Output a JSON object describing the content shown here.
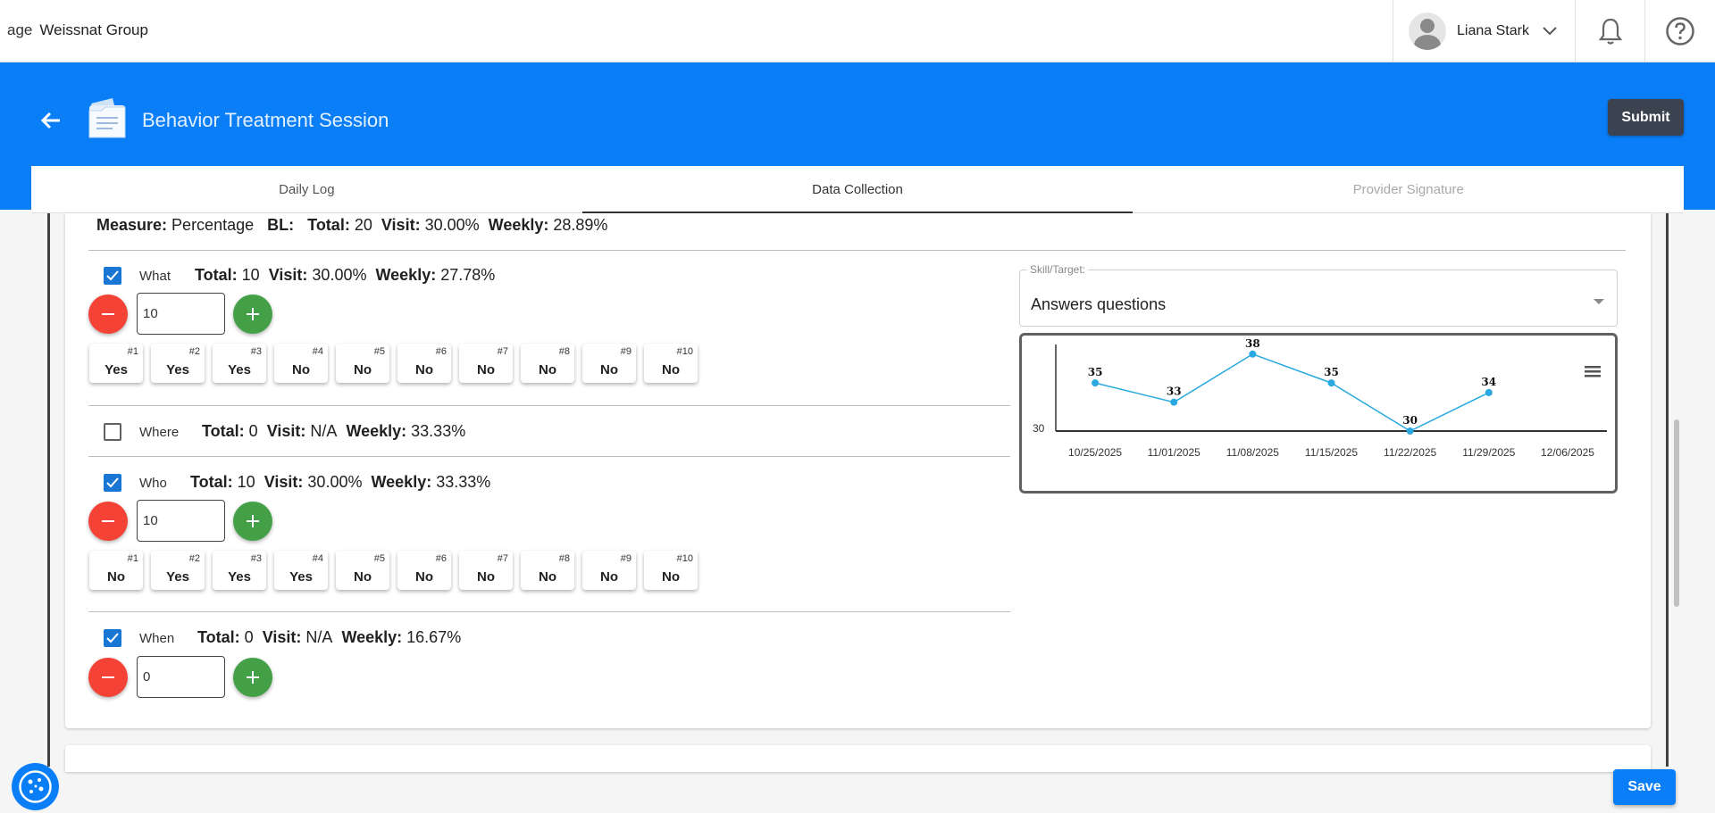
{
  "header": {
    "logo_alt": "age",
    "org_name": "Weissnat Group",
    "user_name": "Liana Stark"
  },
  "page": {
    "title": "Behavior Treatment Session",
    "submit_label": "Submit",
    "save_label": "Save"
  },
  "tabs": [
    {
      "label": "Daily Log",
      "state": "normal"
    },
    {
      "label": "Data Collection",
      "state": "active"
    },
    {
      "label": "Provider Signature",
      "state": "disabled"
    }
  ],
  "measure": {
    "measure_label": "Measure:",
    "measure_value": "Percentage",
    "bl_label": "BL:",
    "total_label": "Total:",
    "total_value": "20",
    "visit_label": "Visit:",
    "visit_value": "30.00%",
    "weekly_label": "Weekly:",
    "weekly_value": "28.89%"
  },
  "questions": [
    {
      "label": "What",
      "checked": true,
      "total": "10",
      "visit": "30.00%",
      "weekly": "27.78%",
      "count": "10",
      "trials": [
        {
          "n": "#1",
          "v": "Yes"
        },
        {
          "n": "#2",
          "v": "Yes"
        },
        {
          "n": "#3",
          "v": "Yes"
        },
        {
          "n": "#4",
          "v": "No"
        },
        {
          "n": "#5",
          "v": "No"
        },
        {
          "n": "#6",
          "v": "No"
        },
        {
          "n": "#7",
          "v": "No"
        },
        {
          "n": "#8",
          "v": "No"
        },
        {
          "n": "#9",
          "v": "No"
        },
        {
          "n": "#10",
          "v": "No"
        }
      ]
    },
    {
      "label": "Where",
      "checked": false,
      "total": "0",
      "visit": "N/A",
      "weekly": "33.33%"
    },
    {
      "label": "Who",
      "checked": true,
      "total": "10",
      "visit": "30.00%",
      "weekly": "33.33%",
      "count": "10",
      "trials": [
        {
          "n": "#1",
          "v": "No"
        },
        {
          "n": "#2",
          "v": "Yes"
        },
        {
          "n": "#3",
          "v": "Yes"
        },
        {
          "n": "#4",
          "v": "Yes"
        },
        {
          "n": "#5",
          "v": "No"
        },
        {
          "n": "#6",
          "v": "No"
        },
        {
          "n": "#7",
          "v": "No"
        },
        {
          "n": "#8",
          "v": "No"
        },
        {
          "n": "#9",
          "v": "No"
        },
        {
          "n": "#10",
          "v": "No"
        }
      ]
    },
    {
      "label": "When",
      "checked": true,
      "total": "0",
      "visit": "N/A",
      "weekly": "16.67%",
      "count": "0"
    }
  ],
  "stat_labels": {
    "total": "Total:",
    "visit": "Visit:",
    "weekly": "Weekly:"
  },
  "skill": {
    "label": "Skill/Target:",
    "value": "Answers questions"
  },
  "chart_data": {
    "type": "line",
    "x": [
      "10/25/2025",
      "11/01/2025",
      "11/08/2025",
      "11/15/2025",
      "11/22/2025",
      "11/29/2025",
      "12/06/2025"
    ],
    "series": [
      {
        "values": [
          35,
          33,
          38,
          35,
          30,
          34,
          null
        ]
      }
    ],
    "y_tick_labels": [
      "30"
    ],
    "ylim": [
      30,
      39
    ],
    "grid": false,
    "line_color": "#29a9e0"
  },
  "icons": {
    "back": "arrow-left-icon",
    "document": "document-icon",
    "bell": "bell-icon",
    "help": "help-icon",
    "menu": "hamburger-menu-icon",
    "cookie": "cookie-icon"
  },
  "colors": {
    "brand_blue": "#0a7ef7",
    "minus_red": "#f44336",
    "plus_green": "#43a047",
    "checkbox_blue": "#1976d2"
  }
}
